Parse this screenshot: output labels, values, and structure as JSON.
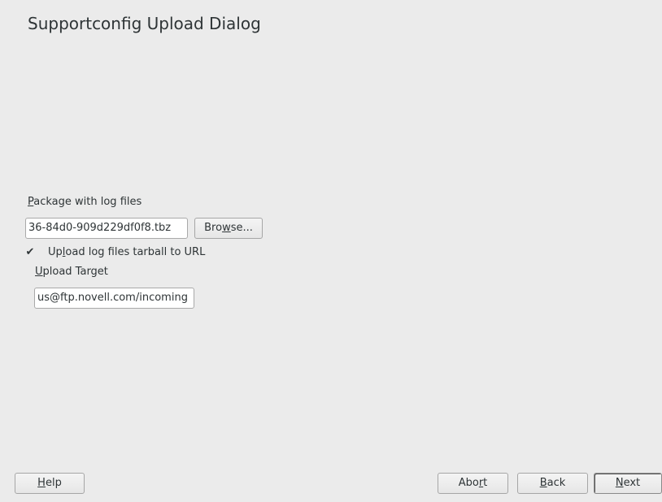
{
  "dialog": {
    "title": "Supportconfig Upload Dialog"
  },
  "package": {
    "label_pre": "",
    "label_mnemonic": "P",
    "label_post": "ackage with log files",
    "value": "36-84d0-909d229df0f8.tbz",
    "browse_pre": "Bro",
    "browse_mnemonic": "w",
    "browse_post": "se..."
  },
  "upload": {
    "checked": true,
    "checkbox_glyph": "✔",
    "label_pre": "Up",
    "label_mnemonic": "l",
    "label_post": "oad log files tarball to URL",
    "target_label_pre": "",
    "target_label_mnemonic": "U",
    "target_label_post": "pload Target",
    "target_value": "us@ftp.novell.com/incoming"
  },
  "footer": {
    "help_mnemonic": "H",
    "help_post": "elp",
    "abort_pre": "Abo",
    "abort_mnemonic": "r",
    "abort_post": "t",
    "back_mnemonic": "B",
    "back_post": "ack",
    "next_mnemonic": "N",
    "next_post": "ext"
  }
}
